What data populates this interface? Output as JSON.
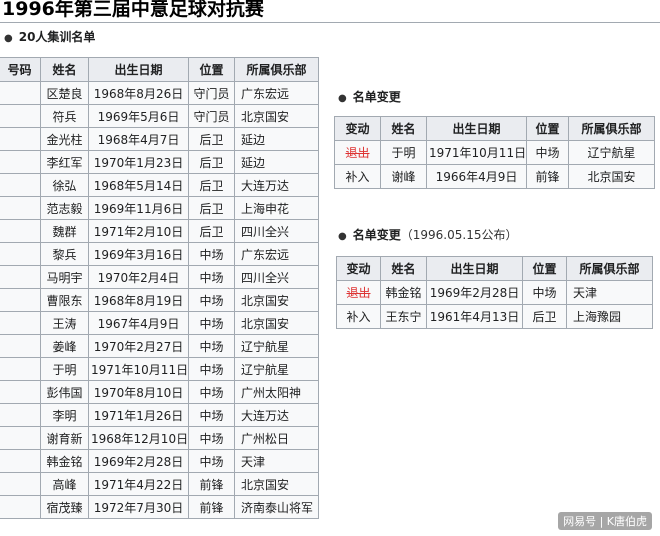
{
  "title": "1996年第三届中意足球对抗赛",
  "roster_section": "20人集训名单",
  "roster": {
    "headers": [
      "号码",
      "姓名",
      "出生日期",
      "位置",
      "所属俱乐部"
    ],
    "rows": [
      [
        "",
        "区楚良",
        "1968年8月26日",
        "守门员",
        "广东宏远"
      ],
      [
        "",
        "符兵",
        "1969年5月6日",
        "守门员",
        "北京国安"
      ],
      [
        "",
        "金光柱",
        "1968年4月7日",
        "后卫",
        "延边"
      ],
      [
        "",
        "李红军",
        "1970年1月23日",
        "后卫",
        "延边"
      ],
      [
        "",
        "徐弘",
        "1968年5月14日",
        "后卫",
        "大连万达"
      ],
      [
        "",
        "范志毅",
        "1969年11月6日",
        "后卫",
        "上海申花"
      ],
      [
        "",
        "魏群",
        "1971年2月10日",
        "后卫",
        "四川全兴"
      ],
      [
        "",
        "黎兵",
        "1969年3月16日",
        "中场",
        "广东宏远"
      ],
      [
        "",
        "马明宇",
        "1970年2月4日",
        "中场",
        "四川全兴"
      ],
      [
        "",
        "曹限东",
        "1968年8月19日",
        "中场",
        "北京国安"
      ],
      [
        "",
        "王涛",
        "1967年4月9日",
        "中场",
        "北京国安"
      ],
      [
        "",
        "姜峰",
        "1970年2月27日",
        "中场",
        "辽宁航星"
      ],
      [
        "",
        "于明",
        "1971年10月11日",
        "中场",
        "辽宁航星"
      ],
      [
        "",
        "彭伟国",
        "1970年8月10日",
        "中场",
        "广州太阳神"
      ],
      [
        "",
        "李明",
        "1971年1月26日",
        "中场",
        "大连万达"
      ],
      [
        "",
        "谢育新",
        "1968年12月10日",
        "中场",
        "广州松日"
      ],
      [
        "",
        "韩金铭",
        "1969年2月28日",
        "中场",
        "天津"
      ],
      [
        "",
        "高峰",
        "1971年4月22日",
        "前锋",
        "北京国安"
      ],
      [
        "",
        "宿茂臻",
        "1972年7月30日",
        "前锋",
        "济南泰山将军"
      ]
    ]
  },
  "change1": {
    "heading": "名单变更",
    "headers": [
      "变动",
      "姓名",
      "出生日期",
      "位置",
      "所属俱乐部"
    ],
    "rows": [
      [
        "退出",
        "于明",
        "1971年10月11日",
        "中场",
        "辽宁航星"
      ],
      [
        "补入",
        "谢峰",
        "1966年4月9日",
        "前锋",
        "北京国安"
      ]
    ]
  },
  "change2": {
    "heading": "名单变更",
    "note": "（1996.05.15公布）",
    "headers": [
      "变动",
      "姓名",
      "出生日期",
      "位置",
      "所属俱乐部"
    ],
    "rows": [
      [
        "退出",
        "韩金铭",
        "1969年2月28日",
        "中场",
        "天津"
      ],
      [
        "补入",
        "王东宁",
        "1961年4月13日",
        "后卫",
        "上海豫园"
      ]
    ]
  },
  "watermark": "网易号 | K唐伯虎",
  "colors": {
    "header_bg": "#eaecf0",
    "cell_bg": "#f8f9fa",
    "border": "#a2a9b1",
    "withdrawn": "#d33333"
  }
}
